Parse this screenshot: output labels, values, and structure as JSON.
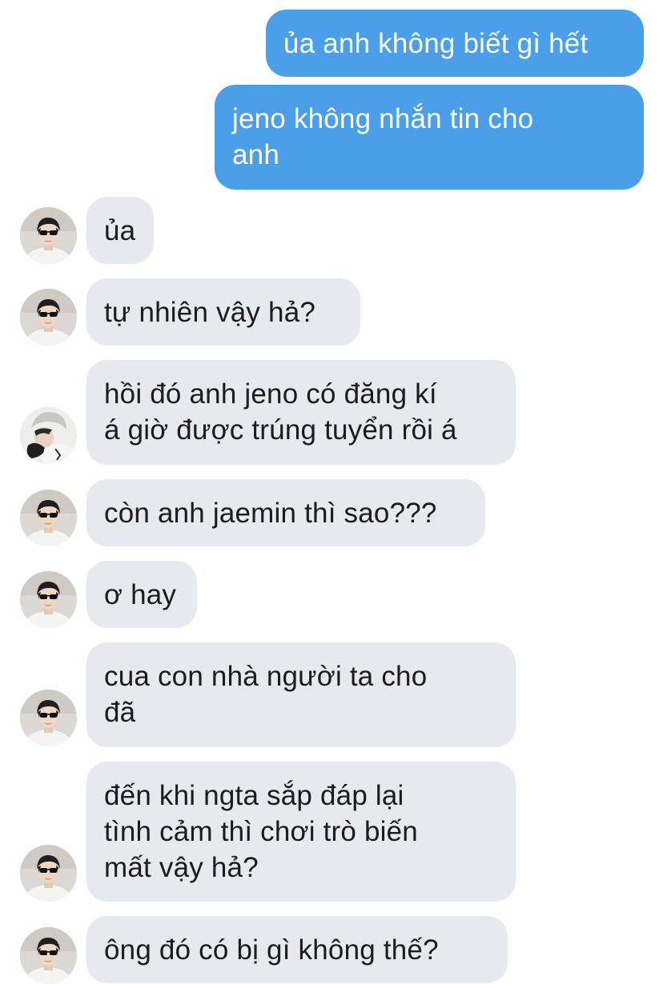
{
  "colors": {
    "sent_bubble": "#4b9fe8",
    "received_bubble": "#e6e9ee",
    "background": "#ffffff"
  },
  "messages": [
    {
      "direction": "sent",
      "text": "ủa anh không biết gì hết"
    },
    {
      "direction": "sent",
      "text": "jeno không nhắn tin cho\nanh"
    },
    {
      "direction": "received",
      "text": "ủa",
      "avatar": "sunglasses-avatar"
    },
    {
      "direction": "received",
      "text": "tự nhiên vậy hả?",
      "avatar": "sunglasses-avatar"
    },
    {
      "direction": "received",
      "text": "hồi đó anh jeno có đăng kí\ná giờ được trúng tuyển rồi á",
      "avatar": "beanie-avatar"
    },
    {
      "direction": "received",
      "text": "còn anh jaemin thì sao???",
      "avatar": "sunglasses-avatar"
    },
    {
      "direction": "received",
      "text": "ơ hay",
      "avatar": "sunglasses-avatar"
    },
    {
      "direction": "received",
      "text": "cua con nhà người ta cho\nđã",
      "avatar": "sunglasses-avatar"
    },
    {
      "direction": "received",
      "text": "đến khi ngta sắp đáp lại\ntình cảm thì chơi trò biến\nmất vậy hả?",
      "avatar": "sunglasses-avatar"
    },
    {
      "direction": "received",
      "text": "ông đó có bị gì không thế?",
      "avatar": "sunglasses-avatar"
    }
  ]
}
